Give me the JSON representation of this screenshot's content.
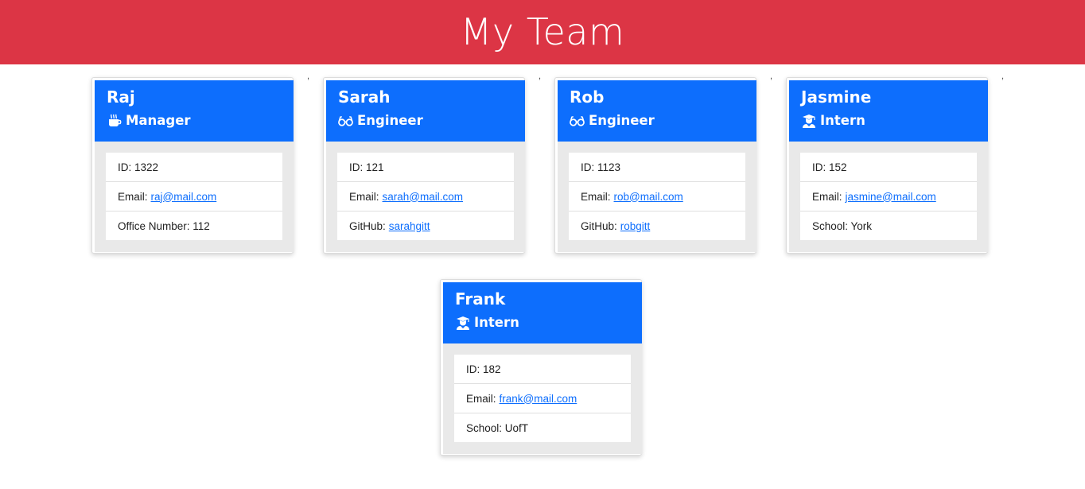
{
  "header": {
    "title": "My Team"
  },
  "colors": {
    "header_bg": "#dc3545",
    "card_header_bg": "#0d6efd",
    "link": "#0d6efd"
  },
  "employees": [
    {
      "name": "Raj",
      "role": "Manager",
      "role_icon": "mug-hot-icon",
      "id_text": "ID: 1322",
      "email_label": "Email:",
      "email": "raj@mail.com",
      "extra_label": "Office Number: 112",
      "extra_link": ""
    },
    {
      "name": "Sarah",
      "role": "Engineer",
      "role_icon": "glasses-icon",
      "id_text": "ID: 121",
      "email_label": "Email:",
      "email": "sarah@mail.com",
      "extra_label": "GitHub:",
      "extra_link": "sarahgitt"
    },
    {
      "name": "Rob",
      "role": "Engineer",
      "role_icon": "glasses-icon",
      "id_text": "ID: 1123",
      "email_label": "Email:",
      "email": "rob@mail.com",
      "extra_label": "GitHub:",
      "extra_link": "robgitt"
    },
    {
      "name": "Jasmine",
      "role": "Intern",
      "role_icon": "user-graduate-icon",
      "id_text": "ID: 152",
      "email_label": "Email:",
      "email": "jasmine@mail.com",
      "extra_label": "School: York",
      "extra_link": ""
    },
    {
      "name": "Frank",
      "role": "Intern",
      "role_icon": "user-graduate-icon",
      "id_text": "ID: 182",
      "email_label": "Email:",
      "email": "frank@mail.com",
      "extra_label": "School: UofT",
      "extra_link": ""
    }
  ],
  "separators": [
    ",",
    ",",
    ",",
    ","
  ]
}
